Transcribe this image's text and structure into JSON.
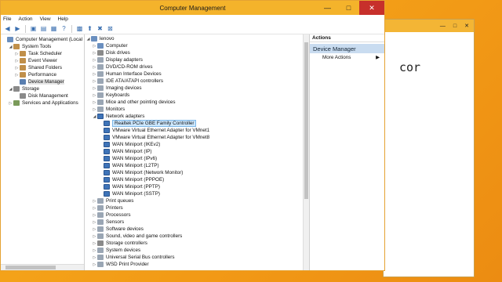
{
  "window": {
    "title": "Computer Management",
    "controls": [
      "—",
      "□",
      "✕"
    ]
  },
  "background_window": {
    "text": "cor",
    "controls": [
      "—",
      "□",
      "✕"
    ]
  },
  "menu": [
    "File",
    "Action",
    "View",
    "Help"
  ],
  "toolbar_icons": [
    "back-arrow-icon",
    "forward-arrow-icon",
    "up-folder-icon",
    "show-hide-tree-icon",
    "properties-icon",
    "help-icon",
    "scan-hardware-icon",
    "update-driver-icon",
    "disable-device-icon",
    "uninstall-device-icon"
  ],
  "left_tree": [
    {
      "label": "Computer Management (Local",
      "level": 0,
      "exp": "",
      "icon": "computer-icon"
    },
    {
      "label": "System Tools",
      "level": 1,
      "exp": "◢",
      "icon": "tools-icon"
    },
    {
      "label": "Task Scheduler",
      "level": 2,
      "exp": "▷",
      "icon": "clock-icon"
    },
    {
      "label": "Event Viewer",
      "level": 2,
      "exp": "▷",
      "icon": "event-viewer-icon"
    },
    {
      "label": "Shared Folders",
      "level": 2,
      "exp": "▷",
      "icon": "folder-icon"
    },
    {
      "label": "Performance",
      "level": 2,
      "exp": "▷",
      "icon": "performance-icon"
    },
    {
      "label": "Device Manager",
      "level": 2,
      "exp": "",
      "icon": "device-manager-icon",
      "selected": true
    },
    {
      "label": "Storage",
      "level": 1,
      "exp": "◢",
      "icon": "storage-icon"
    },
    {
      "label": "Disk Management",
      "level": 2,
      "exp": "",
      "icon": "disk-icon"
    },
    {
      "label": "Services and Applications",
      "level": 1,
      "exp": "▷",
      "icon": "services-icon"
    }
  ],
  "device_tree": [
    {
      "label": "lenovo",
      "level": 0,
      "exp": "◢",
      "icon": "computer-icon"
    },
    {
      "label": "Computer",
      "level": 1,
      "exp": "▷",
      "icon": "computer-icon"
    },
    {
      "label": "Disk drives",
      "level": 1,
      "exp": "▷",
      "icon": "disk-icon"
    },
    {
      "label": "Display adapters",
      "level": 1,
      "exp": "▷",
      "icon": "display-icon"
    },
    {
      "label": "DVD/CD-ROM drives",
      "level": 1,
      "exp": "▷",
      "icon": "dvd-icon"
    },
    {
      "label": "Human Interface Devices",
      "level": 1,
      "exp": "▷",
      "icon": "hid-icon"
    },
    {
      "label": "IDE ATA/ATAPI controllers",
      "level": 1,
      "exp": "▷",
      "icon": "ide-icon"
    },
    {
      "label": "Imaging devices",
      "level": 1,
      "exp": "▷",
      "icon": "camera-icon"
    },
    {
      "label": "Keyboards",
      "level": 1,
      "exp": "▷",
      "icon": "keyboard-icon"
    },
    {
      "label": "Mice and other pointing devices",
      "level": 1,
      "exp": "▷",
      "icon": "mouse-icon"
    },
    {
      "label": "Monitors",
      "level": 1,
      "exp": "▷",
      "icon": "monitor-icon"
    },
    {
      "label": "Network adapters",
      "level": 1,
      "exp": "◢",
      "icon": "network-icon"
    },
    {
      "label": "Realtek PCIe GBE Family Controller",
      "level": 2,
      "exp": "",
      "icon": "network-adapter-icon",
      "selected": true
    },
    {
      "label": "VMware Virtual Ethernet Adapter for VMnet1",
      "level": 2,
      "exp": "",
      "icon": "network-adapter-icon"
    },
    {
      "label": "VMware Virtual Ethernet Adapter for VMnet8",
      "level": 2,
      "exp": "",
      "icon": "network-adapter-icon"
    },
    {
      "label": "WAN Miniport (IKEv2)",
      "level": 2,
      "exp": "",
      "icon": "network-adapter-icon"
    },
    {
      "label": "WAN Miniport (IP)",
      "level": 2,
      "exp": "",
      "icon": "network-adapter-icon"
    },
    {
      "label": "WAN Miniport (IPv6)",
      "level": 2,
      "exp": "",
      "icon": "network-adapter-icon"
    },
    {
      "label": "WAN Miniport (L2TP)",
      "level": 2,
      "exp": "",
      "icon": "network-adapter-icon"
    },
    {
      "label": "WAN Miniport (Network Monitor)",
      "level": 2,
      "exp": "",
      "icon": "network-adapter-icon"
    },
    {
      "label": "WAN Miniport (PPPOE)",
      "level": 2,
      "exp": "",
      "icon": "network-adapter-icon"
    },
    {
      "label": "WAN Miniport (PPTP)",
      "level": 2,
      "exp": "",
      "icon": "network-adapter-icon"
    },
    {
      "label": "WAN Miniport (SSTP)",
      "level": 2,
      "exp": "",
      "icon": "network-adapter-icon"
    },
    {
      "label": "Print queues",
      "level": 1,
      "exp": "▷",
      "icon": "printer-icon"
    },
    {
      "label": "Printers",
      "level": 1,
      "exp": "▷",
      "icon": "printer-icon"
    },
    {
      "label": "Processors",
      "level": 1,
      "exp": "▷",
      "icon": "processor-icon"
    },
    {
      "label": "Sensors",
      "level": 1,
      "exp": "▷",
      "icon": "sensor-icon"
    },
    {
      "label": "Software devices",
      "level": 1,
      "exp": "▷",
      "icon": "software-device-icon"
    },
    {
      "label": "Sound, video and game controllers",
      "level": 1,
      "exp": "▷",
      "icon": "sound-icon"
    },
    {
      "label": "Storage controllers",
      "level": 1,
      "exp": "▷",
      "icon": "storage-icon"
    },
    {
      "label": "System devices",
      "level": 1,
      "exp": "▷",
      "icon": "system-device-icon"
    },
    {
      "label": "Universal Serial Bus controllers",
      "level": 1,
      "exp": "▷",
      "icon": "usb-icon"
    },
    {
      "label": "WSD Print Provider",
      "level": 1,
      "exp": "▷",
      "icon": "printer-icon"
    }
  ],
  "actions": {
    "header": "Actions",
    "section": "Device Manager",
    "items": [
      {
        "label": "More Actions",
        "arrow": "▶"
      }
    ]
  },
  "colors": {
    "title_bar": "#f4b32b",
    "close_button": "#c7302b",
    "selection": "#cde8ff",
    "actions_section": "#c9dcf0"
  }
}
